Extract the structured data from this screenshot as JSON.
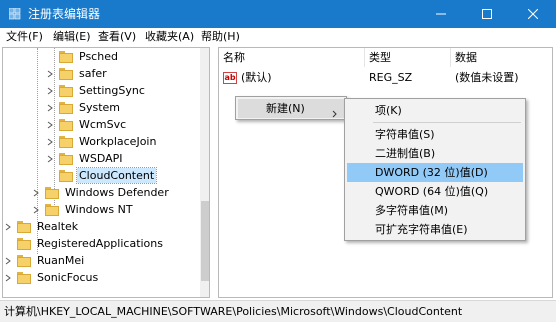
{
  "window": {
    "title": "注册表编辑器",
    "title_bar_color": "#1979ca"
  },
  "menubar": {
    "items": [
      "文件(F)",
      "编辑(E)",
      "查看(V)",
      "收藏夹(A)",
      "帮助(H)"
    ]
  },
  "tree": {
    "items": [
      {
        "label": "Psched"
      },
      {
        "label": "safer"
      },
      {
        "label": "SettingSync"
      },
      {
        "label": "System"
      },
      {
        "label": "WcmSvc"
      },
      {
        "label": "WorkplaceJoin"
      },
      {
        "label": "WSDAPI"
      },
      {
        "label": "CloudContent",
        "selected": true
      },
      {
        "label": "Windows Defender"
      },
      {
        "label": "Windows NT"
      },
      {
        "label": "Realtek"
      },
      {
        "label": "RegisteredApplications"
      },
      {
        "label": "RuanMei"
      },
      {
        "label": "SonicFocus"
      }
    ]
  },
  "values_pane": {
    "columns": [
      "名称",
      "类型",
      "数据"
    ],
    "rows": [
      {
        "name": "(默认)",
        "type": "REG_SZ",
        "data": "(数值未设置)"
      }
    ]
  },
  "context_menu": {
    "new_label": "新建(N)",
    "submenu": {
      "key_label": "项(K)",
      "items": [
        "字符串值(S)",
        "二进制值(B)",
        "DWORD (32 位)值(D)",
        "QWORD (64 位)值(Q)",
        "多字符串值(M)",
        "可扩充字符串值(E)"
      ],
      "highlighted": "DWORD (32 位)值(D)",
      "highlight_color": "#91c9f7"
    }
  },
  "statusbar": {
    "path": "计算机\\HKEY_LOCAL_MACHINE\\SOFTWARE\\Policies\\Microsoft\\Windows\\CloudContent"
  }
}
